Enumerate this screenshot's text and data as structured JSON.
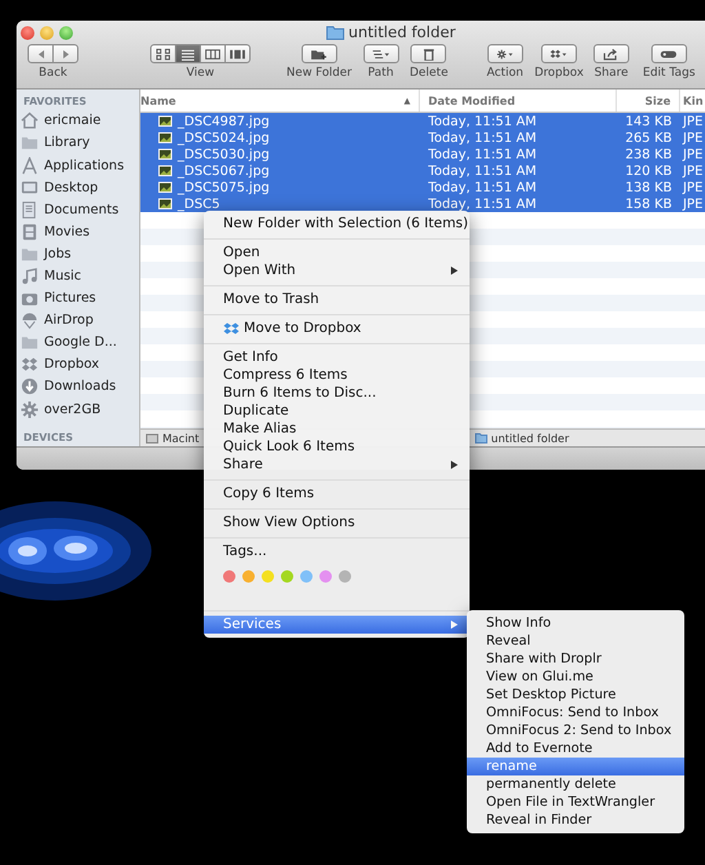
{
  "window": {
    "title": "untitled folder"
  },
  "toolbar": {
    "items": [
      {
        "kind": "back",
        "label": "Back"
      },
      {
        "kind": "view",
        "label": "View",
        "segments": [
          {
            "selected": false
          },
          {
            "selected": true
          },
          {
            "selected": false
          },
          {
            "selected": false
          }
        ]
      },
      {
        "kind": "newfolder",
        "label": "New Folder"
      },
      {
        "kind": "path",
        "label": "Path"
      },
      {
        "kind": "delete",
        "label": "Delete"
      },
      {
        "kind": "action",
        "label": "Action"
      },
      {
        "kind": "dropbox",
        "label": "Dropbox"
      },
      {
        "kind": "share",
        "label": "Share"
      },
      {
        "kind": "tags",
        "label": "Edit Tags"
      }
    ]
  },
  "sidebar": {
    "sections": [
      {
        "title": "FAVORITES",
        "items": [
          {
            "label": "ericmaie"
          },
          {
            "label": "Library"
          },
          {
            "label": "Applications"
          },
          {
            "label": "Desktop"
          },
          {
            "label": "Documents"
          },
          {
            "label": "Movies"
          },
          {
            "label": "Jobs"
          },
          {
            "label": "Music"
          },
          {
            "label": "Pictures"
          },
          {
            "label": "AirDrop"
          },
          {
            "label": "Google D..."
          },
          {
            "label": "Dropbox"
          },
          {
            "label": "Downloads"
          },
          {
            "label": "over2GB"
          }
        ]
      },
      {
        "title": "DEVICES"
      }
    ]
  },
  "file_list": {
    "columns": [
      "Name",
      "Date Modified",
      "Size",
      "Kin"
    ],
    "sort_indicator": "▲",
    "rows": [
      {
        "name": "_DSC4987.jpg",
        "date": "Today, 11:51 AM",
        "size": "143 KB",
        "column_4": "JPE",
        "selected": true
      },
      {
        "name": "_DSC5024.jpg",
        "date": "Today, 11:51 AM",
        "size": "265 KB",
        "column_4": "JPE",
        "selected": true
      },
      {
        "name": "_DSC5030.jpg",
        "date": "Today, 11:51 AM",
        "size": "238 KB",
        "column_4": "JPE",
        "selected": true
      },
      {
        "name": "_DSC5067.jpg",
        "date": "Today, 11:51 AM",
        "size": "120 KB",
        "column_4": "JPE",
        "selected": true
      },
      {
        "name": "_DSC5075.jpg",
        "date": "Today, 11:51 AM",
        "size": "138 KB",
        "column_4": "JPE",
        "selected": true
      },
      {
        "name": "_DSC5",
        "date": "Today, 11:51 AM",
        "size": "158 KB",
        "column_4": "JPE",
        "selected": true
      }
    ]
  },
  "path_bar": [
    {
      "label": "Macint"
    },
    {
      "label": "untitled folder"
    }
  ],
  "context_menu": {
    "items": [
      {
        "kind": "item",
        "label": "New Folder with Selection (6 Items)",
        "submenu": false,
        "selected": false
      },
      {
        "kind": "separator"
      },
      {
        "kind": "item",
        "label": "Open",
        "submenu": false,
        "selected": false
      },
      {
        "kind": "item",
        "label": "Open With",
        "submenu": true,
        "selected": false
      },
      {
        "kind": "separator"
      },
      {
        "kind": "item",
        "label": "Move to Trash",
        "submenu": false,
        "selected": false
      },
      {
        "kind": "separator"
      },
      {
        "kind": "dropbox",
        "label": "Move to Dropbox",
        "submenu": false,
        "selected": false
      },
      {
        "kind": "separator"
      },
      {
        "kind": "item",
        "label": "Get Info",
        "submenu": false,
        "selected": false
      },
      {
        "kind": "item",
        "label": "Compress 6 Items",
        "submenu": false,
        "selected": false
      },
      {
        "kind": "item",
        "label": "Burn 6 Items to Disc...",
        "submenu": false,
        "selected": false
      },
      {
        "kind": "item",
        "label": "Duplicate",
        "submenu": false,
        "selected": false
      },
      {
        "kind": "item",
        "label": "Make Alias",
        "submenu": false,
        "selected": false
      },
      {
        "kind": "item",
        "label": "Quick Look 6 Items",
        "submenu": false,
        "selected": false
      },
      {
        "kind": "item",
        "label": "Share",
        "submenu": true,
        "selected": false
      },
      {
        "kind": "separator"
      },
      {
        "kind": "item",
        "label": "Copy 6 Items",
        "submenu": false,
        "selected": false
      },
      {
        "kind": "separator"
      },
      {
        "kind": "item",
        "label": "Show View Options",
        "submenu": false,
        "selected": false
      },
      {
        "kind": "separator"
      },
      {
        "kind": "item",
        "label": "Tags...",
        "submenu": false,
        "selected": false
      },
      {
        "kind": "tags",
        "colors": [
          {
            "color": "#f07878"
          },
          {
            "color": "#f8b030"
          },
          {
            "color": "#f4e020"
          },
          {
            "color": "#a4d820"
          },
          {
            "color": "#80c0f8"
          },
          {
            "color": "#e490f0"
          },
          {
            "color": "#b4b4b4"
          }
        ]
      },
      {
        "kind": "separator"
      },
      {
        "kind": "item",
        "label": "Services",
        "submenu": true,
        "selected": true
      }
    ]
  },
  "services_menu": {
    "items": [
      {
        "label": "Show Info",
        "selected": false
      },
      {
        "label": "Reveal",
        "selected": false
      },
      {
        "label": "Share with Droplr",
        "selected": false
      },
      {
        "label": "View on Glui.me",
        "selected": false
      },
      {
        "label": "Set Desktop Picture",
        "selected": false
      },
      {
        "label": "OmniFocus: Send to Inbox",
        "selected": false
      },
      {
        "label": "OmniFocus 2: Send to Inbox",
        "selected": false
      },
      {
        "label": "Add to Evernote",
        "selected": false
      },
      {
        "label": "rename",
        "selected": true
      },
      {
        "label": "permanently delete",
        "selected": false
      },
      {
        "label": "Open File in TextWrangler",
        "selected": false
      },
      {
        "label": "Reveal in Finder",
        "selected": false
      }
    ]
  }
}
